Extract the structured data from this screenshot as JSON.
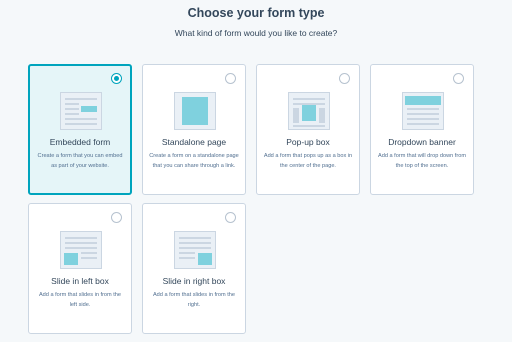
{
  "header": {
    "title": "Choose your form type",
    "subtitle": "What kind of form would you like to create?"
  },
  "selected_option": "Embedded form",
  "colors": {
    "accent": "#00a4bd",
    "selected_bg": "#e5f5f8",
    "preview_form": "#7fd1de",
    "border": "#cbd6e2"
  },
  "options": [
    {
      "title": "Embedded form",
      "description": "Create a form that you can embed as part of your website.",
      "selected": true
    },
    {
      "title": "Standalone page",
      "description": "Create a form on a standalone page that you can share through a link.",
      "selected": false
    },
    {
      "title": "Pop-up box",
      "description": "Add a form that pops up as a box in the center of the page.",
      "selected": false
    },
    {
      "title": "Dropdown banner",
      "description": "Add a form that will drop down from the top of the screen.",
      "selected": false
    },
    {
      "title": "Slide in left box",
      "description": "Add a form that slides in from the left side.",
      "selected": false
    },
    {
      "title": "Slide in right box",
      "description": "Add a form that slides in from the right.",
      "selected": false
    }
  ]
}
